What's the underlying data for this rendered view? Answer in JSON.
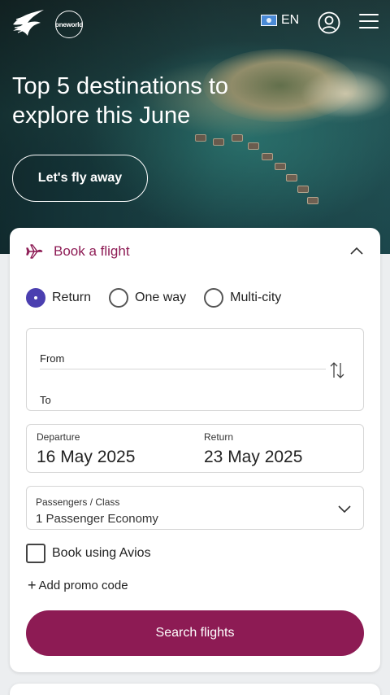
{
  "header": {
    "oneworld_logo_text": "oneworld",
    "language": "EN"
  },
  "hero": {
    "title": "Top 5 destinations to explore this June",
    "cta_label": "Let's fly away"
  },
  "booking": {
    "title": "Book a flight",
    "trip_types": [
      {
        "label": "Return",
        "selected": true
      },
      {
        "label": "One way",
        "selected": false
      },
      {
        "label": "Multi-city",
        "selected": false
      }
    ],
    "from_label": "From",
    "to_label": "To",
    "departure_label": "Departure",
    "departure_value": "16 May 2025",
    "return_label": "Return",
    "return_value": "23 May 2025",
    "passengers_label": "Passengers / Class",
    "passengers_value": "1  Passenger Economy",
    "avios_label": "Book using Avios",
    "promo_label": "Add promo code",
    "search_label": "Search flights"
  },
  "colors": {
    "brand": "#8d1b54",
    "radio_selected": "#4b3fb0"
  }
}
